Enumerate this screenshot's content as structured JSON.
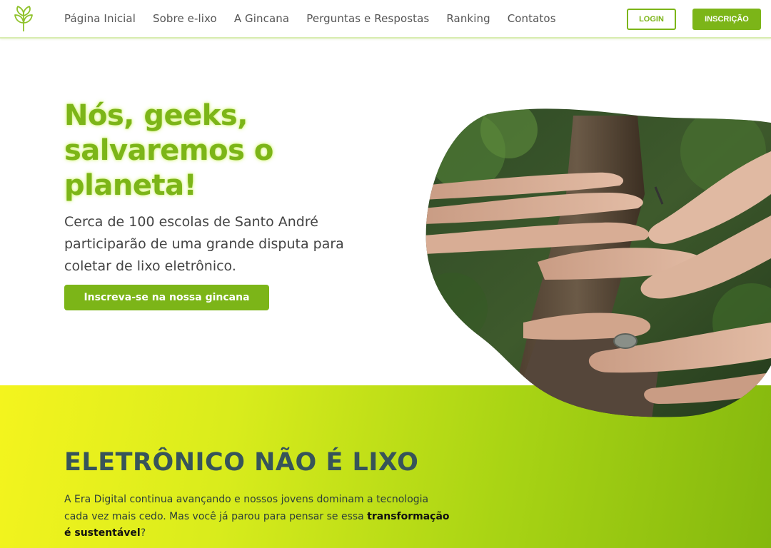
{
  "header": {
    "logo": "leaf-logo-icon",
    "nav": [
      {
        "label": "Página Inicial"
      },
      {
        "label": "Sobre e-lixo"
      },
      {
        "label": "A Gincana"
      },
      {
        "label": "Perguntas e Respostas"
      },
      {
        "label": "Ranking"
      },
      {
        "label": "Contatos"
      }
    ],
    "login_label": "LOGIN",
    "signup_label": "INSCRIÇÃO"
  },
  "hero": {
    "title": "Nós, geeks, salvaremos o planeta!",
    "text": "Cerca de 100 escolas de Santo André participarão de uma grande disputa para coletar de lixo eletrônico.",
    "cta_label": "Inscreva-se na nossa gincana",
    "image": "hands-on-tree-trunk-photo"
  },
  "section": {
    "title": "ELETRÔNICO NÃO É LIXO",
    "text_part1": "A Era Digital continua avançando e nossos jovens dominam a tecnologia cada vez mais cedo. Mas você já parou para pensar se essa ",
    "text_bold": "transformação é sustentável",
    "text_part2": "?"
  },
  "colors": {
    "accent": "#7cb518",
    "heading_dark": "#37545a",
    "band_start": "#f4f41e",
    "band_end": "#84b80e"
  }
}
